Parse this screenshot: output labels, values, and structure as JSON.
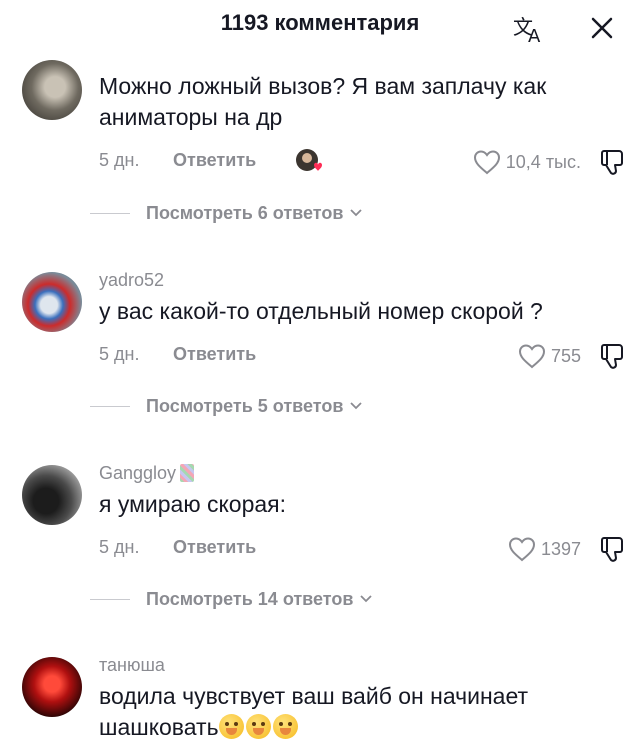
{
  "header": {
    "title": "1193 комментария",
    "translate_icon": "translate-icon",
    "close_icon": "close-icon"
  },
  "comments": [
    {
      "username": "",
      "text": "Можно ложный вызов? Я вам заплачу как аниматоры на др",
      "date": "5 дн.",
      "reply_label": "Ответить",
      "likes": "10,4 тыс.",
      "view_replies": "Посмотреть 6 ответов"
    },
    {
      "username": "yadro52",
      "text": "у вас какой-то отдельный номер скорой ?",
      "date": "5 дн.",
      "reply_label": "Ответить",
      "likes": "755",
      "view_replies": "Посмотреть 5 ответов"
    },
    {
      "username": "Gangglоy",
      "text": "я умираю скорая:",
      "date": "5 дн.",
      "reply_label": "Ответить",
      "likes": "1397",
      "view_replies": "Посмотреть 14 ответов"
    },
    {
      "username": "танюша",
      "text": "водила чувствует ваш вайб он начинает шашковать"
    }
  ],
  "colors": {
    "text": "#161823",
    "muted": "#8a8b91",
    "heart_badge": "#fe2c55"
  }
}
